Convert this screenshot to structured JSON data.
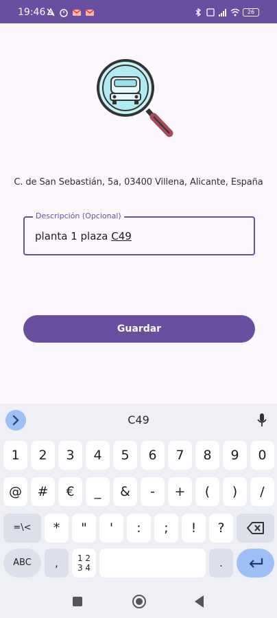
{
  "status_bar": {
    "time": "19:46",
    "battery": "26"
  },
  "address": "C. de San Sebastián, 5a, 03400 Villena, Alicante, España",
  "description_field": {
    "label": "Descripción (Opcional)",
    "value_prefix": "planta 1 plaza ",
    "value_underlined": "C49"
  },
  "save_button": "Guardar",
  "keyboard": {
    "suggestion": "C49",
    "row_numbers": [
      "1",
      "2",
      "3",
      "4",
      "5",
      "6",
      "7",
      "8",
      "9",
      "0"
    ],
    "row_symbols1": [
      "@",
      "#",
      "€",
      "_",
      "&",
      "-",
      "+",
      "(",
      ")",
      "/"
    ],
    "row_symbols2": [
      "=\\<",
      "*",
      "\"",
      "'",
      ":",
      ";",
      "!",
      "?"
    ],
    "abc_label": "ABC",
    "comma": ",",
    "numpad_label_top": "1 2",
    "numpad_label_bottom": "3 4",
    "period": "."
  },
  "colors": {
    "primary": "#6a4fa0",
    "background": "#fdf8fe",
    "keyboard_bg": "#eef0f6",
    "accent_blue": "#9cc0f5"
  }
}
